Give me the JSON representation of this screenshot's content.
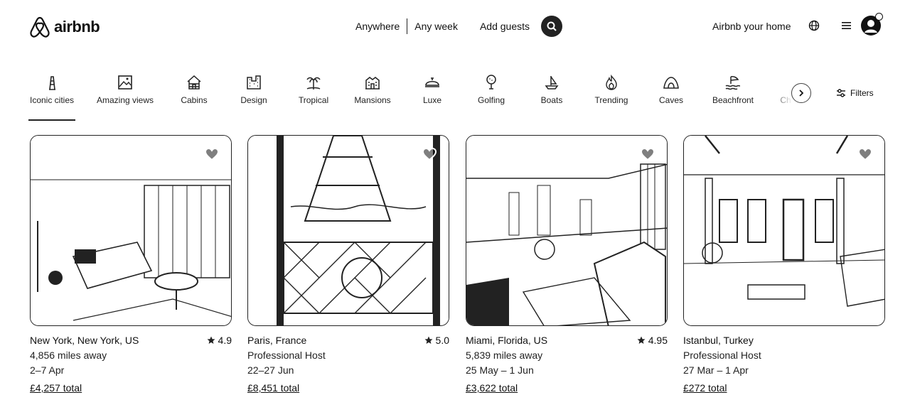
{
  "brand": {
    "name": "airbnb",
    "icon": "airbnb-logo-icon"
  },
  "search": {
    "anywhere": "Anywhere",
    "any_week": "Any week",
    "add_guests": "Add guests",
    "icon": "search-icon"
  },
  "header_right": {
    "host_link": "Airbnb your home",
    "globe_icon": "globe-icon",
    "menu_icon": "menu-icon",
    "avatar_icon": "user-avatar-icon"
  },
  "categories": [
    {
      "label": "Iconic cities",
      "icon": "iconic-cities-icon",
      "active": true
    },
    {
      "label": "Amazing views",
      "icon": "amazing-views-icon"
    },
    {
      "label": "Cabins",
      "icon": "cabins-icon"
    },
    {
      "label": "Design",
      "icon": "design-icon"
    },
    {
      "label": "Tropical",
      "icon": "tropical-icon"
    },
    {
      "label": "Mansions",
      "icon": "mansions-icon"
    },
    {
      "label": "Luxe",
      "icon": "luxe-icon"
    },
    {
      "label": "Golfing",
      "icon": "golfing-icon"
    },
    {
      "label": "Boats",
      "icon": "boats-icon"
    },
    {
      "label": "Trending",
      "icon": "trending-icon"
    },
    {
      "label": "Caves",
      "icon": "caves-icon"
    },
    {
      "label": "Beachfront",
      "icon": "beachfront-icon"
    },
    {
      "label": "Ch",
      "icon": "partial-category-icon"
    }
  ],
  "filters": {
    "label": "Filters",
    "icon": "filters-icon"
  },
  "listings": [
    {
      "location": "New York, New York, US",
      "rating": "4.9",
      "subtitle": "4,856 miles away",
      "dates": "2–7 Apr",
      "price": "£4,257 total"
    },
    {
      "location": "Paris, France",
      "rating": "5.0",
      "subtitle": "Professional Host",
      "dates": "22–27 Jun",
      "price": "£8,451 total"
    },
    {
      "location": "Miami, Florida, US",
      "rating": "4.95",
      "subtitle": "5,839 miles away",
      "dates": "25 May – 1 Jun",
      "price": "£3,622 total"
    },
    {
      "location": "Istanbul, Turkey",
      "rating": "",
      "subtitle": "Professional Host",
      "dates": "27 Mar – 1 Apr",
      "price": "£272 total"
    }
  ]
}
